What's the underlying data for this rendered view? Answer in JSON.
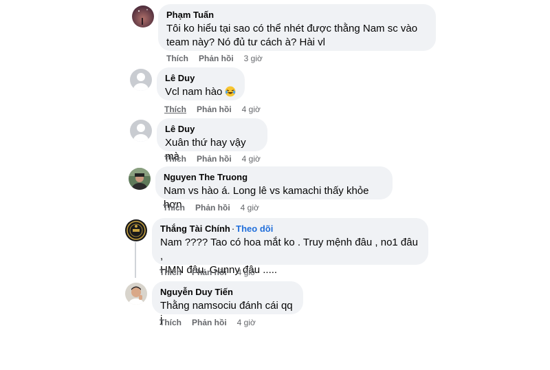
{
  "comments": [
    {
      "name": "Phạm Tuấn",
      "line1": "Tôi ko hiểu tại sao có thể nhét được thằng Nam sc vào",
      "line2": "team này? Nó đủ tư cách à? Hài vl",
      "like": "Thích",
      "reply": "Phản hồi",
      "time": "3 giờ",
      "avatar": "night-sky-avatar"
    },
    {
      "name": "Lê Duy",
      "line1": "Vcl nam hào",
      "like": "Thích",
      "reply": "Phản hồi",
      "time": "4 giờ",
      "avatar": "default-avatar",
      "emoji": "laughing-crying-emoji"
    },
    {
      "name": "Lê Duy",
      "line1": "Xuân thứ hay vậy mà",
      "like": "Thích",
      "reply": "Phản hồi",
      "time": "4 giờ",
      "avatar": "default-avatar"
    },
    {
      "name": "Nguyen The Truong",
      "line1": "Nam vs hào á. Long lê vs kamachi thấy khỏe hơn",
      "like": "Thích",
      "reply": "Phản hồi",
      "time": "4 giờ",
      "avatar": "photo-avatar"
    },
    {
      "name": "Thắng Tài Chính",
      "follow": "Theo dõi",
      "separator": "·",
      "line1": "Nam ???? Tao có hoa mắt ko . Truy mệnh đâu , no1 đâu ,",
      "line2": "HMN đâu. Gunny đâu .....",
      "like": "Thích",
      "reply": "Phản hồi",
      "time": "4 giờ",
      "avatar": "logo-avatar"
    },
    {
      "name": "Nguyễn Duy Tiến",
      "line1": "Thằng namsociu đánh cái qq j",
      "like": "Thích",
      "reply": "Phản hồi",
      "time": "4 giờ",
      "avatar": "photo-avatar"
    }
  ],
  "colors": {
    "bubble": "#f0f2f5",
    "meta": "#65676b",
    "follow": "#216fdb"
  }
}
